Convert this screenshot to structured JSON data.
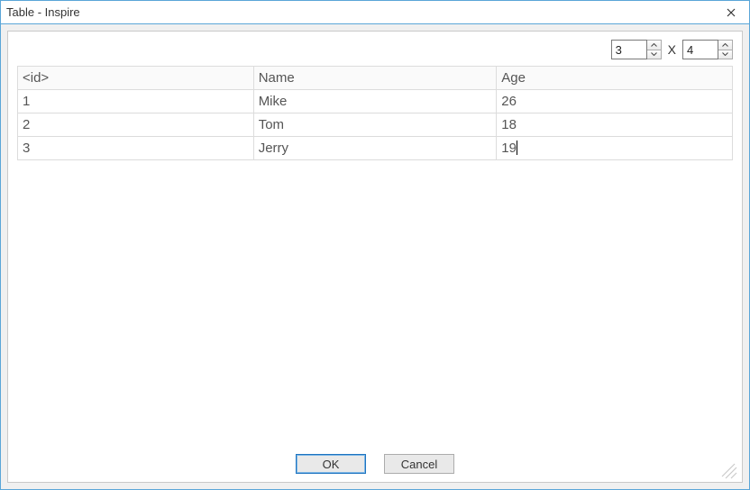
{
  "window": {
    "title": "Table - Inspire"
  },
  "dimensions": {
    "rows": "3",
    "separator": "X",
    "cols": "4"
  },
  "table": {
    "headers": [
      "<id>",
      "Name",
      "Age"
    ],
    "rows": [
      {
        "id": "1",
        "name": "Mike",
        "age": "26"
      },
      {
        "id": "2",
        "name": "Tom",
        "age": "18"
      },
      {
        "id": "3",
        "name": "Jerry",
        "age": "19"
      }
    ],
    "editing_cell": {
      "row": 2,
      "col": "age"
    }
  },
  "buttons": {
    "ok": "OK",
    "cancel": "Cancel"
  }
}
